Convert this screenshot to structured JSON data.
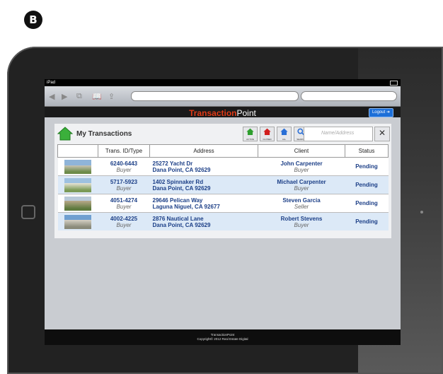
{
  "badge": "B",
  "status_bar": {
    "device": "iPad"
  },
  "app": {
    "logo_main": "Transaction",
    "logo_suffix": "Point",
    "logout_label": "Logout"
  },
  "panel": {
    "title": "My Transactions",
    "tools": [
      {
        "label": "ACTIVE",
        "color": "#2e9e2e"
      },
      {
        "label": "CLOSED",
        "color": "#d11f1f"
      },
      {
        "label": "ALL",
        "color": "#2a6fd6"
      },
      {
        "label": "SEARCH",
        "color": "#2a6fd6"
      }
    ],
    "filter_placeholder": "Name/Address",
    "clear_label": "CLEAR"
  },
  "table": {
    "headers": [
      "",
      "Trans. ID/Type",
      "Address",
      "Client",
      "Status"
    ],
    "rows": [
      {
        "id": "6240-6443",
        "type": "Buyer",
        "addr1": "25272 Yacht Dr",
        "addr2": "Dana Point, CA 92629",
        "client": "John Carpenter",
        "role": "Buyer",
        "status": "Pending"
      },
      {
        "id": "5717-5923",
        "type": "Buyer",
        "addr1": "1402 Spinnaker Rd",
        "addr2": "Dana Point, CA 92629",
        "client": "Michael Carpenter",
        "role": "Buyer",
        "status": "Pending"
      },
      {
        "id": "4051-4274",
        "type": "Buyer",
        "addr1": "29646 Pelican Way",
        "addr2": "Laguna Niguel, CA 92677",
        "client": "Steven Garcia",
        "role": "Seller",
        "status": "Pending"
      },
      {
        "id": "4002-4225",
        "type": "Buyer",
        "addr1": "2876 Nautical Lane",
        "addr2": "Dana Point, CA 92629",
        "client": "Robert Stevens",
        "role": "Buyer",
        "status": "Pending"
      }
    ]
  },
  "footer": {
    "line1": "TransactionPoint",
    "line2": "Copyright© 2012 Real Estate Digital"
  },
  "colors": {
    "accent": "#1c3f87",
    "alt_row": "#dce9f7",
    "logo_red": "#e03a17",
    "logout_blue": "#1d6fd8"
  }
}
